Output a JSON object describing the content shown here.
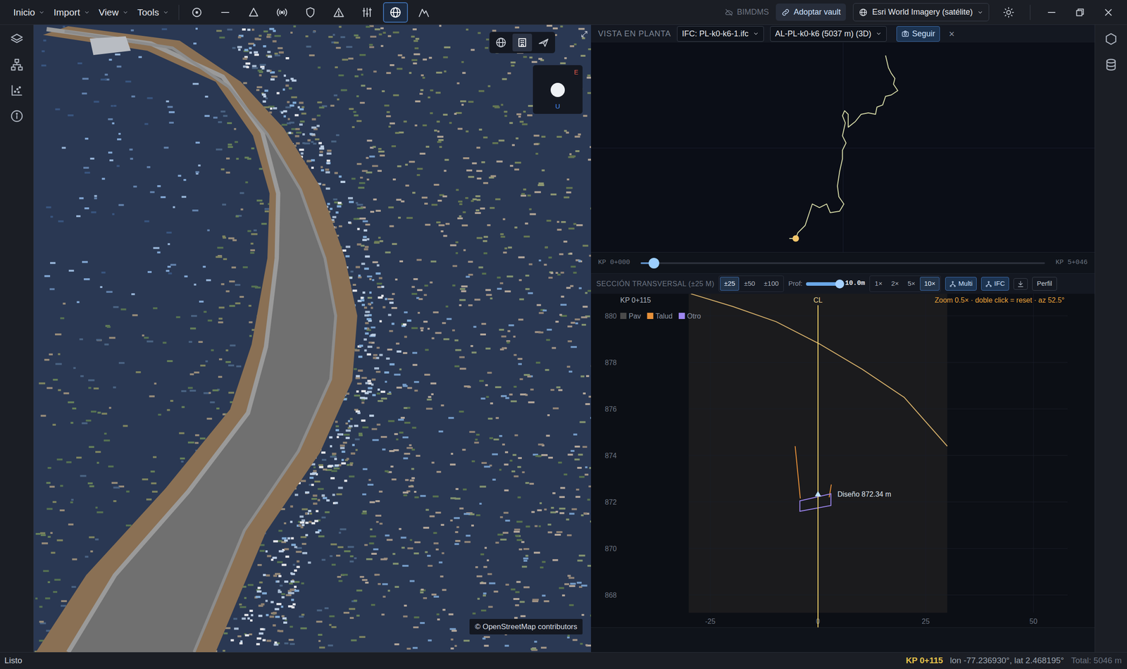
{
  "menubar": {
    "menus": [
      "Inicio",
      "Import",
      "View",
      "Tools"
    ],
    "tools": [
      {
        "selected": false
      },
      {
        "selected": false
      },
      {
        "selected": false
      },
      {
        "selected": false
      },
      {
        "selected": false
      },
      {
        "selected": false
      },
      {
        "selected": false
      },
      {
        "selected": true
      },
      {
        "selected": false
      }
    ],
    "bimdms": {
      "label": "BIMDMS",
      "disabled": true
    },
    "adopt": "Adoptar vault",
    "basemap": "Esri World Imagery (satélite)"
  },
  "viewport": {
    "view_modes": [
      {
        "selected": false
      },
      {
        "selected": true
      },
      {
        "selected": false
      }
    ],
    "compass": {
      "east": "E",
      "up": "U"
    },
    "attribution": "© OpenStreetMap contributors"
  },
  "plan": {
    "title": "VISTA EN PLANTA",
    "ifc": "IFC: PL-k0-k6-1.ifc",
    "alignment": "AL-PL-k0-k6 (5037 m) (3D)",
    "follow": {
      "label": "Seguir",
      "on": true
    },
    "close": "×",
    "crosshair": [
      351,
      147
    ],
    "track": [
      [
        410,
        18
      ],
      [
        414,
        35
      ],
      [
        418,
        43
      ],
      [
        423,
        50
      ],
      [
        421,
        58
      ],
      [
        427,
        67
      ],
      [
        418,
        73
      ],
      [
        410,
        75
      ],
      [
        406,
        87
      ],
      [
        398,
        90
      ],
      [
        396,
        100
      ],
      [
        386,
        98
      ],
      [
        376,
        100
      ],
      [
        368,
        110
      ],
      [
        358,
        118
      ],
      [
        358,
        100
      ],
      [
        353,
        95
      ],
      [
        350,
        102
      ],
      [
        354,
        112
      ],
      [
        350,
        130
      ],
      [
        355,
        140
      ],
      [
        350,
        150
      ],
      [
        350,
        162
      ],
      [
        346,
        180
      ],
      [
        343,
        200
      ],
      [
        345,
        215
      ],
      [
        352,
        225
      ],
      [
        346,
        235
      ],
      [
        333,
        237
      ],
      [
        328,
        225
      ],
      [
        318,
        230
      ],
      [
        308,
        225
      ],
      [
        303,
        240
      ],
      [
        298,
        255
      ],
      [
        288,
        265
      ],
      [
        285,
        273
      ]
    ],
    "marker": [
      285,
      273
    ]
  },
  "slider": {
    "start": "KP 0+000",
    "end": "KP 5+046",
    "level": 0.033
  },
  "section": {
    "title": "SECCIÓN TRANSVERSAL (±25 M)",
    "ranges": [
      {
        "label": "±25",
        "selected": true
      },
      {
        "label": "±50",
        "selected": false
      },
      {
        "label": "±100",
        "selected": false
      }
    ],
    "depth": {
      "label": "Prof:",
      "level": 0.95,
      "reading": "10.0m"
    },
    "zooms": [
      {
        "label": "1×",
        "selected": false
      },
      {
        "label": "2×",
        "selected": false
      },
      {
        "label": "5×",
        "selected": false
      },
      {
        "label": "10×",
        "selected": true
      }
    ],
    "multi": {
      "label": "Multi",
      "on": true
    },
    "ifc": {
      "label": "IFC",
      "on": true
    },
    "profile": "Perfil",
    "chart": {
      "kp": "KP 0+115",
      "cl": "CL",
      "note": "Zoom 0.5× · doble click = reset · az 52.5°",
      "legend": [
        {
          "label": "Pav",
          "color": "#4a4a4a"
        },
        {
          "label": "Talud",
          "color": "#e8913a"
        },
        {
          "label": "Otro",
          "color": "#9d86f0"
        }
      ],
      "y_ticks": [
        "880",
        "878",
        "876",
        "874",
        "872",
        "870",
        "868"
      ],
      "x_ticks": [
        "-25",
        "0",
        "25",
        "50"
      ],
      "band": [
        -30,
        30
      ],
      "terrain": [
        [
          -29.5,
          880.95
        ],
        [
          -19.7,
          880.4
        ],
        [
          -9.7,
          879.75
        ],
        [
          0.3,
          878.8
        ],
        [
          10.3,
          877.7
        ],
        [
          20,
          876.5
        ],
        [
          30,
          874.4
        ]
      ],
      "talud": [
        [
          [
            -5.3,
            874.4
          ],
          [
            -4.1,
            872.15
          ]
        ],
        [
          [
            3.1,
            872.75
          ],
          [
            2.6,
            872.2
          ]
        ]
      ],
      "otro": [
        [
          -4.2,
          872.05
        ],
        [
          3.0,
          872.35
        ],
        [
          3.0,
          871.85
        ],
        [
          -4.2,
          871.6
        ]
      ],
      "design": {
        "label": "Diseño 872.34 m",
        "elevation": 872.34,
        "offset": 0
      }
    }
  },
  "status_bar": {
    "left": "Listo",
    "kp": "KP 0+115",
    "position": "lon -77.236930°, lat 2.468195°",
    "total": "Total: 5046 m"
  }
}
